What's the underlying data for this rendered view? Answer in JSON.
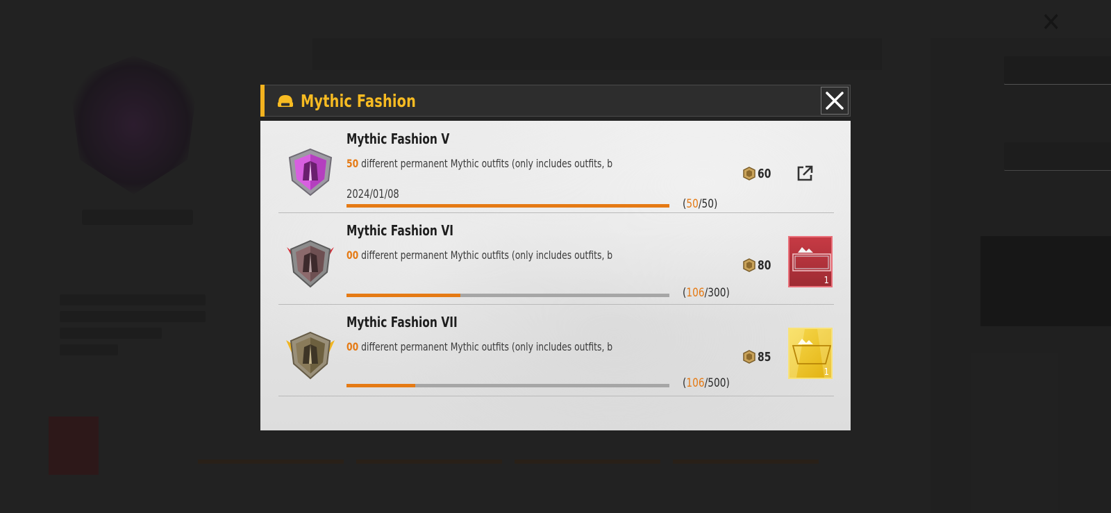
{
  "modal": {
    "title": "Mythic Fashion",
    "accent_color": "#f7bb22",
    "progress_color": "#e57a14",
    "header_icon": "helmet-icon",
    "close_icon": "close-icon"
  },
  "achievements": [
    {
      "name": "Mythic Fashion V",
      "count_prefix": "50",
      "description": " different permanent Mythic outfits (only includes outfits, b",
      "date": "2024/01/08",
      "progress_current": "50",
      "progress_total": "50",
      "progress_fraction": 1.0,
      "points": "60",
      "badge_icon": "purple-shield-badge-icon",
      "action": "external-link-icon"
    },
    {
      "name": "Mythic Fashion VI",
      "count_prefix": "00",
      "description": " different permanent Mythic outfits (only includes outfits, b",
      "date": "",
      "progress_current": "106",
      "progress_total": "300",
      "progress_fraction": 0.353,
      "points": "80",
      "badge_icon": "red-winged-shield-badge-icon",
      "reward_quantity": "1",
      "reward_color": "#c63a44"
    },
    {
      "name": "Mythic Fashion VII",
      "count_prefix": "00",
      "description": " different permanent Mythic outfits (only includes outfits, b",
      "date": "",
      "progress_current": "106",
      "progress_total": "500",
      "progress_fraction": 0.212,
      "points": "85",
      "badge_icon": "gold-winged-shield-badge-icon",
      "reward_quantity": "1",
      "reward_color": "#f2c729"
    }
  ]
}
